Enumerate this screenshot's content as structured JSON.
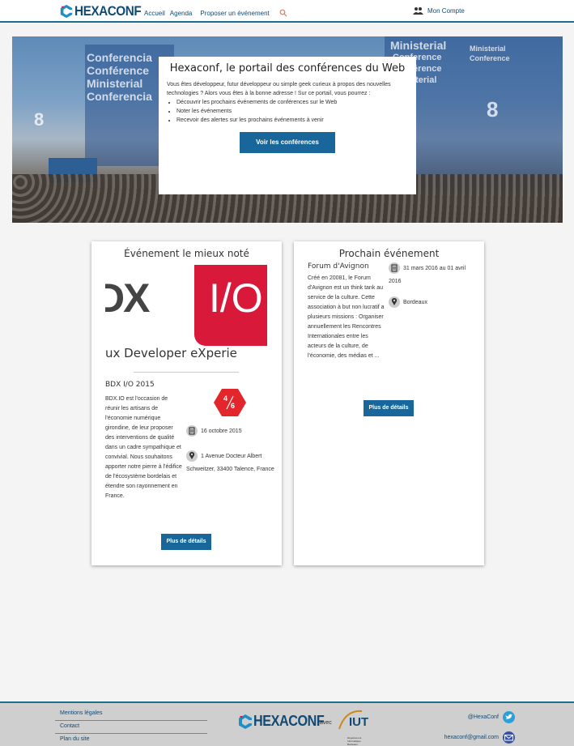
{
  "nav": {
    "logo": "HEXACONF",
    "links": [
      "Accueil",
      "Agenda",
      "Proposer un événement"
    ],
    "account": "Mon Compte"
  },
  "hero": {
    "background_words": [
      "Conferencia",
      "Conférence",
      "Ministerial",
      "Conferencia",
      "Conférence",
      "Ministerial",
      "Ministerial",
      "Conference",
      "Conference",
      "Conférence",
      "Ministerial"
    ],
    "title": "Hexaconf, le portail des conférences du Web",
    "intro": "Vous êtes développeur, futur développeur ou simple geek curieux à propos des nouvelles technologies ? Alors vous êtes à la bonne adresse ! Sur ce portail, vous pourrez :",
    "bullets": [
      "Découvrir les prochains événements de conférences sur le Web",
      "Noter les événements",
      "Recevoir des alertes sur les prochains événements à venir"
    ],
    "cta": "Voir les conférences"
  },
  "best_event": {
    "heading": "Événement le mieux noté",
    "logo_text_dx": "DX",
    "logo_text_io": "I/O",
    "logo_subtitle": "ux Developer eXperie",
    "name": "BDX I/O 2015",
    "rating_top": "4",
    "rating_bottom": "6",
    "description": "BDX.IO est l'occasion de réunir les artisans de l'économie numérique girondine, de leur proposer des interventions de qualité dans un cadre sympathique et convivial. Nous souhaitons apporter notre pierre à l'édifice de l'écosystème bordelais et étendre son rayonnement en France.",
    "date": "16 octobre 2015",
    "address": "1 Avenue Docteur Albert Schweitzer, 33400 Talence, France",
    "details_button": "Plus de détails"
  },
  "next_event": {
    "heading": "Prochain événement",
    "name": "Forum d'Avignon",
    "description": "Créé en 20081, le Forum d'Avignon est un think tank au service de la culture. Cette association à but non lucratif a plusieurs missions : Organiser annuellement les Rencontres Internationales entre les acteurs de la culture, de l'économie, des médias et ...",
    "date": "31 mars 2016 au 01 avril 2016",
    "location": "Bordeaux",
    "details_button": "Plus de détails"
  },
  "footer": {
    "links": [
      "Mentions légales",
      "Contact",
      "Plan du site"
    ],
    "logo": "HEXACONF",
    "avec": "avec",
    "partner_logo": "IUT",
    "partner_caption": "Département Informatique Bordeaux",
    "twitter": "@HexaConf",
    "email": "hexaconf@gmail.com"
  },
  "colors": {
    "primary": "#19679a",
    "brand_blue": "#124a73",
    "accent_red": "#d8193a",
    "nav_border": "#1f6f8b"
  }
}
